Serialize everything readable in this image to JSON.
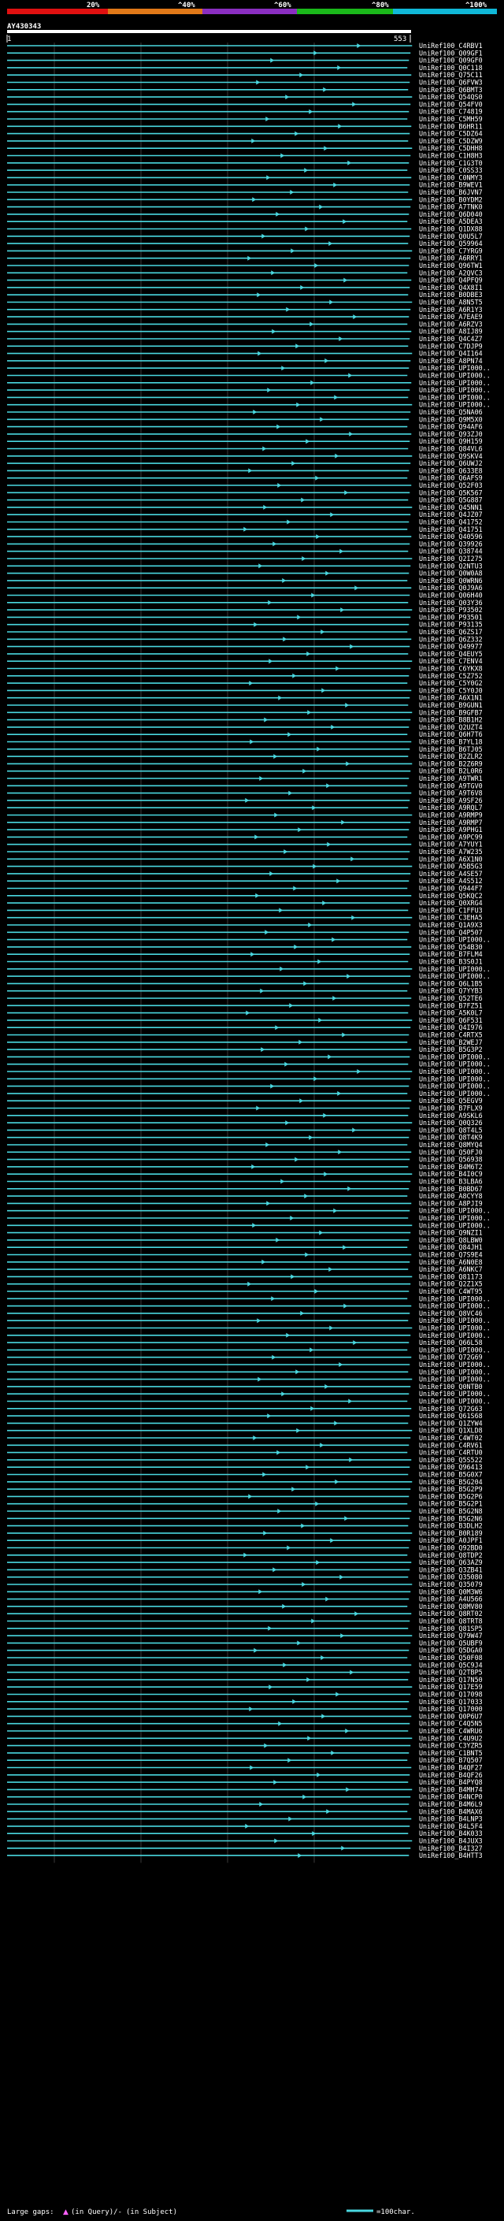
{
  "query_name": "AY430343",
  "query_start": "1",
  "query_end": "553",
  "score_scale": [
    "20%",
    "^40%",
    "^60%",
    "^80%",
    "^100%"
  ],
  "score_colors": [
    "#e01010",
    "#e07818",
    "#8a2ec0",
    "#1ab81a",
    "#10b8d8"
  ],
  "hit_color": "#4ad8e0",
  "insert_color": "#ff60ff",
  "legend": {
    "gaps": "Large gaps:",
    "in_query": "(in Query)/-",
    "in_subject": "(in Subject)",
    "scale": "=100char."
  },
  "chart_data": {
    "type": "alignment",
    "title": "AY430343",
    "query_length": 553,
    "hits": [
      "UniRef100_C4RBV1",
      "UniRef100_Q09GF1",
      "UniRef100_Q09GF0",
      "UniRef100_Q0C118",
      "UniRef100_Q75C11",
      "UniRef100_Q6FVW3",
      "UniRef100_Q6BMT3",
      "UniRef100_Q54QS0",
      "UniRef100_Q54FV0",
      "UniRef100_C74819",
      "UniRef100_C5MH59",
      "UniRef100_B6HR11",
      "UniRef100_C5DZ64",
      "UniRef100_C5DZW9",
      "UniRef100_C5DHH8",
      "UniRef100_C1H8H3",
      "UniRef100_C1G3T0",
      "UniRef100_C0SS33",
      "UniRef100_C0NMY3",
      "UniRef100_B9WEV1",
      "UniRef100_B6JVN7",
      "UniRef100_B0YDM2",
      "UniRef100_A7TNK0",
      "UniRef100_Q6D040",
      "UniRef100_A5DEA3",
      "UniRef100_Q1DX88",
      "UniRef100_Q0U5L7",
      "UniRef100_Q59964",
      "UniRef100_C7YRG9",
      "UniRef100_A6RRY1",
      "UniRef100_Q96TW1",
      "UniRef100_A2QVC3",
      "UniRef100_Q4PFQ9",
      "UniRef100_Q4X8I1",
      "UniRef100_B0DBE3",
      "UniRef100_A8N5T5",
      "UniRef100_A6R1Y3",
      "UniRef100_A7EAE9",
      "UniRef100_A6RZV3",
      "UniRef100_A8IJ89",
      "UniRef100_Q4C4Z7",
      "UniRef100_C7DJP9",
      "UniRef100_Q4I164",
      "UniRef100_A8PN74",
      "UniRef100_UPI000..",
      "UniRef100_UPI000..",
      "UniRef100_UPI000..",
      "UniRef100_UPI000..",
      "UniRef100_UPI000..",
      "UniRef100_UPI000..",
      "UniRef100_Q5NA06",
      "UniRef100_Q9M5X0",
      "UniRef100_Q94AF6",
      "UniRef100_Q93ZJ0",
      "UniRef100_Q9H159",
      "UniRef100_Q84VL6",
      "UniRef100_Q9SKV4",
      "UniRef100_Q6UWJ2",
      "UniRef100_Q633E8",
      "UniRef100_Q6AFS9",
      "UniRef100_Q52F03",
      "UniRef100_Q5K567",
      "UniRef100_Q5G887",
      "UniRef100_Q45NN1",
      "UniRef100_Q4JZ07",
      "UniRef100_Q41752",
      "UniRef100_Q41751",
      "UniRef100_Q40596",
      "UniRef100_Q39926",
      "UniRef100_Q38744",
      "UniRef100_Q2I275",
      "UniRef100_Q2NTU3",
      "UniRef100_Q0W0A8",
      "UniRef100_Q0WRN6",
      "UniRef100_Q0J9A6",
      "UniRef100_Q06H40",
      "UniRef100_Q03Y36",
      "UniRef100_P93502",
      "UniRef100_P93501",
      "UniRef100_P93135",
      "UniRef100_Q6ZS17",
      "UniRef100_Q6Z332",
      "UniRef100_Q49977",
      "UniRef100_Q4EUY5",
      "UniRef100_C7ENV4",
      "UniRef100_C6YKX8",
      "UniRef100_C5Z752",
      "UniRef100_C5Y0G2",
      "UniRef100_C5Y0J0",
      "UniRef100_A6X1N1",
      "UniRef100_B9GUN1",
      "UniRef100_B9GFB7",
      "UniRef100_B8B1H2",
      "UniRef100_Q2UZT4",
      "UniRef100_Q6H7T6",
      "UniRef100_B7YL18",
      "UniRef100_B6TJ05",
      "UniRef100_B2ZLR2",
      "UniRef100_B2Z6R9",
      "UniRef100_B2L0R6",
      "UniRef100_A9TWR1",
      "UniRef100_A9TGV0",
      "UniRef100_A9T6V8",
      "UniRef100_A9SF26",
      "UniRef100_A9RQL7",
      "UniRef100_A9RMP9",
      "UniRef100_A9RMP7",
      "UniRef100_A9PHG1",
      "UniRef100_A9PC99",
      "UniRef100_A7YUY1",
      "UniRef100_A7W235",
      "UniRef100_A6X1N0",
      "UniRef100_A5B5G3",
      "UniRef100_A4SE57",
      "UniRef100_A4S512",
      "UniRef100_Q944F7",
      "UniRef100_Q5KQC2",
      "UniRef100_Q0XRG4",
      "UniRef100_C1FFU3",
      "UniRef100_C3EHA5",
      "UniRef100_Q1A9X3",
      "UniRef100_Q4P507",
      "UniRef100_UPI000..",
      "UniRef100_Q54B30",
      "UniRef100_B7FLM4",
      "UniRef100_B3S0J1",
      "UniRef100_UPI000..",
      "UniRef100_UPI000..",
      "UniRef100_Q6L1B5",
      "UniRef100_Q7YYB3",
      "UniRef100_Q52TE6",
      "UniRef100_B7FZ51",
      "UniRef100_A5K0L7",
      "UniRef100_Q6F531",
      "UniRef100_Q4I976",
      "UniRef100_C4RTX5",
      "UniRef100_B2WEJ7",
      "UniRef100_B5G3P2",
      "UniRef100_UPI000..",
      "UniRef100_UPI000..",
      "UniRef100_UPI000..",
      "UniRef100_UPI000..",
      "UniRef100_UPI000..",
      "UniRef100_UPI000..",
      "UniRef100_Q5EGV9",
      "UniRef100_B7FLX9",
      "UniRef100_A9SKL6",
      "UniRef100_Q0Q326",
      "UniRef100_Q8T4L5",
      "UniRef100_Q8T4K9",
      "UniRef100_Q8MYQ4",
      "UniRef100_Q50FJ0",
      "UniRef100_Q56938",
      "UniRef100_B4M6T2",
      "UniRef100_B4I0C9",
      "UniRef100_B3LBA6",
      "UniRef100_B0BD67",
      "UniRef100_A8CYY8",
      "UniRef100_A8PJI9",
      "UniRef100_UPI000..",
      "UniRef100_UPI000..",
      "UniRef100_UPI000..",
      "UniRef100_Q9NZI1",
      "UniRef100_Q8LBW0",
      "UniRef100_Q84JH1",
      "UniRef100_Q7S9E4",
      "UniRef100_A6N0E8",
      "UniRef100_A6NKC7",
      "UniRef100_Q81173",
      "UniRef100_Q2Z1X5",
      "UniRef100_C4WT95",
      "UniRef100_UPI000..",
      "UniRef100_UPI000..",
      "UniRef100_Q8VC46",
      "UniRef100_UPI000..",
      "UniRef100_UPI000..",
      "UniRef100_UPI000..",
      "UniRef100_Q66L58",
      "UniRef100_UPI000..",
      "UniRef100_Q72G69",
      "UniRef100_UPI000..",
      "UniRef100_UPI000..",
      "UniRef100_UPI000..",
      "UniRef100_Q0NTB0",
      "UniRef100_UPI000..",
      "UniRef100_UPI000..",
      "UniRef100_Q72G63",
      "UniRef100_Q61S68",
      "UniRef100_Q1ZYW4",
      "UniRef100_Q1XLD8",
      "UniRef100_C4WT02",
      "UniRef100_C4RV61",
      "UniRef100_C4RTU0",
      "UniRef100_Q5S522",
      "UniRef100_Q96413",
      "UniRef100_B5G0X7",
      "UniRef100_B5G204",
      "UniRef100_B5G2P9",
      "UniRef100_B5G2P6",
      "UniRef100_B5G2P1",
      "UniRef100_B5G2N8",
      "UniRef100_B5G2N6",
      "UniRef100_B3DLH2",
      "UniRef100_B0R189",
      "UniRef100_A0JPF1",
      "UniRef100_Q92BD0",
      "UniRef100_Q8TDP2",
      "UniRef100_Q63AZ9",
      "UniRef100_Q3ZB41",
      "UniRef100_Q35080",
      "UniRef100_Q35079",
      "UniRef100_Q0M3W6",
      "UniRef100_A4U566",
      "UniRef100_Q8MV80",
      "UniRef100_Q8RT02",
      "UniRef100_Q8TRT8",
      "UniRef100_Q81SP5",
      "UniRef100_Q79W47",
      "UniRef100_Q5UBF9",
      "UniRef100_Q5DGA0",
      "UniRef100_Q50F08",
      "UniRef100_Q5C9J4",
      "UniRef100_Q2TBP5",
      "UniRef100_Q17N50",
      "UniRef100_Q17E59",
      "UniRef100_Q17098",
      "UniRef100_Q17033",
      "UniRef100_Q17000",
      "UniRef100_Q0P6U7",
      "UniRef100_C4Q5N5",
      "UniRef100_C4WRU6",
      "UniRef100_C4U9U2",
      "UniRef100_C3YZR5",
      "UniRef100_C1BNT5",
      "UniRef100_B7Q507",
      "UniRef100_B4QF27",
      "UniRef100_B4QF26",
      "UniRef100_B4PYQ8",
      "UniRef100_B4MH74",
      "UniRef100_B4NCP0",
      "UniRef100_B4M6L9",
      "UniRef100_B4MAX6",
      "UniRef100_B4LNP3",
      "UniRef100_B4L5F4",
      "UniRef100_B4K033",
      "UniRef100_B4JUX3",
      "UniRef100_B4I327",
      "UniRef100_B4HTT3"
    ]
  }
}
